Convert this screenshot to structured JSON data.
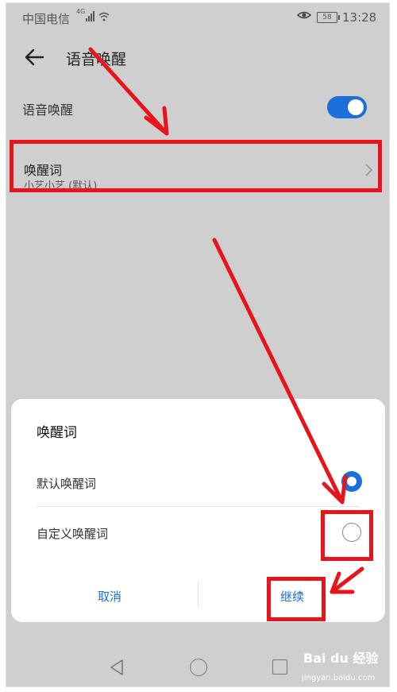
{
  "status_bar": {
    "carrier": "中国电信",
    "network": "4G",
    "signal_icon": "signal-bars",
    "wifi_icon": "wifi",
    "battery": "58",
    "time": "13:28"
  },
  "header": {
    "back_icon": "arrow-left",
    "title": "语音唤醒"
  },
  "settings": {
    "voice_wake_label": "语音唤醒",
    "voice_wake_enabled": true,
    "wake_word_title": "唤醒词",
    "wake_word_value": "小艺小艺 (默认)"
  },
  "dialog": {
    "title": "唤醒词",
    "options": [
      {
        "label": "默认唤醒词",
        "selected": true
      },
      {
        "label": "自定义唤醒词",
        "selected": false
      }
    ],
    "cancel_label": "取消",
    "continue_label": "继续"
  },
  "watermark": {
    "brand": "Bai du 经验",
    "url": "jingyan.baidu.com"
  },
  "colors": {
    "accent": "#1a6fd8",
    "annotation": "#e8141b",
    "background": "#cfcfcf"
  }
}
